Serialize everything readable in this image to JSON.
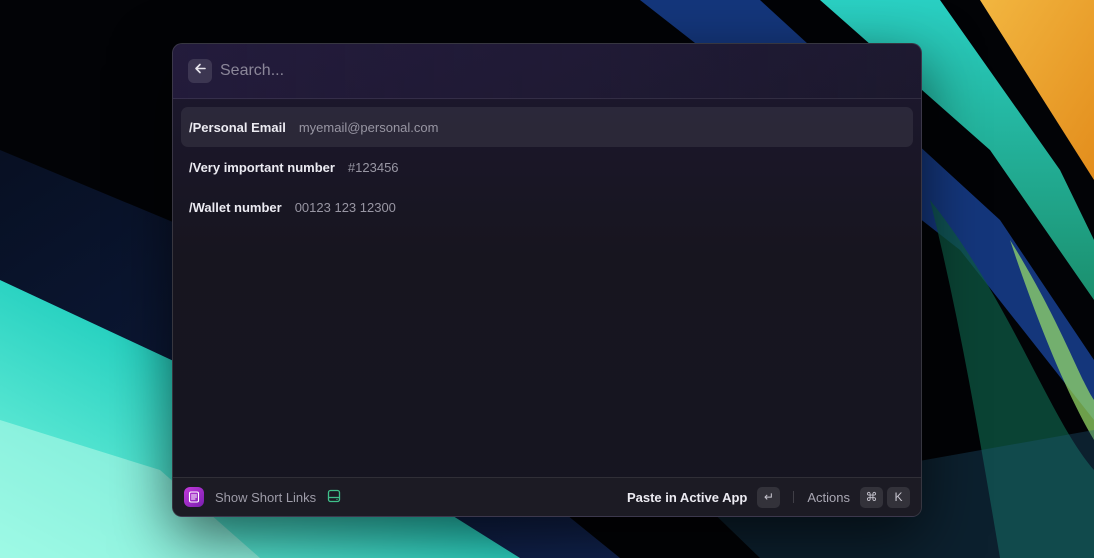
{
  "search": {
    "placeholder": "Search..."
  },
  "items": [
    {
      "title": "/Personal Email",
      "value": "myemail@personal.com",
      "selected": true
    },
    {
      "title": "/Very important number",
      "value": "#123456",
      "selected": false
    },
    {
      "title": "/Wallet number",
      "value": "00123 123 12300",
      "selected": false
    }
  ],
  "footer": {
    "app_label": "Show Short Links",
    "primary_action": "Paste in Active App",
    "primary_key": "↵",
    "secondary_action": "Actions",
    "secondary_keys": [
      "⌘",
      "K"
    ]
  },
  "colors": {
    "accent": "#c23adb",
    "window_bg": "#17151f",
    "selection": "#2a2833"
  },
  "icons": {
    "back": "arrow-left-icon",
    "app": "snippets-icon",
    "footer_extra": "hard-drive-icon"
  }
}
